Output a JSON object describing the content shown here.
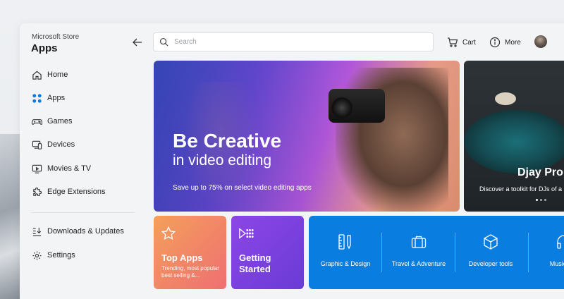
{
  "app": {
    "subtitle": "Microsoft Store",
    "title": "Apps"
  },
  "sidebar": {
    "items": [
      {
        "label": "Home",
        "icon": "home-icon"
      },
      {
        "label": "Apps",
        "icon": "apps-icon",
        "active": true
      },
      {
        "label": "Games",
        "icon": "gamepad-icon"
      },
      {
        "label": "Devices",
        "icon": "devices-icon"
      },
      {
        "label": "Movies & TV",
        "icon": "tv-icon"
      },
      {
        "label": "Edge Extensions",
        "icon": "puzzle-icon"
      }
    ],
    "bottom_items": [
      {
        "label": "Downloads & Updates",
        "icon": "downloads-icon"
      },
      {
        "label": "Settings",
        "icon": "gear-icon"
      }
    ]
  },
  "topbar": {
    "search_placeholder": "Search",
    "cart_label": "Cart",
    "more_label": "More"
  },
  "hero": {
    "title": "Be Creative",
    "subtitle": "in video editing",
    "description": "Save up to 75% on select video editing apps"
  },
  "hero2": {
    "title": "Djay Pro",
    "description": "Discover a toolkit for DJs of a"
  },
  "tiles": [
    {
      "name": "Top Apps",
      "description": "Trending, most popular best selling &...",
      "icon": "star-icon"
    },
    {
      "name": "Getting Started",
      "description": "",
      "icon": "play-grid-icon"
    }
  ],
  "categories": [
    {
      "label": "Graphic & Design",
      "icon": "pen-ruler-icon"
    },
    {
      "label": "Travel & Adventure",
      "icon": "suitcase-icon"
    },
    {
      "label": "Developer tools",
      "icon": "cube-icon"
    },
    {
      "label": "Music & S",
      "icon": "headphones-icon"
    }
  ],
  "colors": {
    "accent": "#0a7de0",
    "top_apps_start": "#f3a05a",
    "top_apps_end": "#ef6f72",
    "getting_started": "#8c46e6"
  }
}
